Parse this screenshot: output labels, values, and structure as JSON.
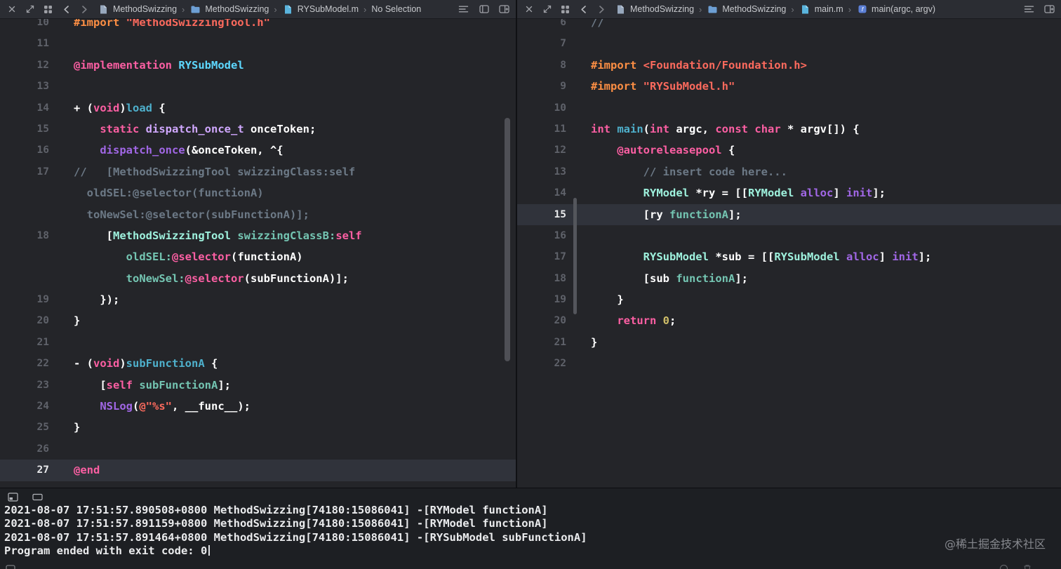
{
  "ui": {
    "breadcrumb_separator": "›"
  },
  "colors": {
    "plain": "#ffffff",
    "keyword": "#FC5FA3",
    "preproc": "#FD8F44",
    "string": "#FC6A5D",
    "comment": "#6C7986",
    "typeDecl": "#5DD8FF",
    "decl": "#4EB0CC",
    "projClass": "#9EF1DD",
    "projMethod": "#74C5B2",
    "otherFn": "#A167E6",
    "otherType": "#D0A8FF",
    "number": "#D0BF69"
  },
  "left_pane": {
    "toolbar_left": [
      "close",
      "expand",
      "grid",
      "back",
      "forward"
    ],
    "toolbar_right": [
      "list",
      "layout",
      "add-editor"
    ],
    "breadcrumbs": [
      {
        "icon": "file",
        "label": "MethodSwizzing"
      },
      {
        "icon": "folder",
        "label": "MethodSwizzing"
      },
      {
        "icon": "file-m",
        "label": "RYSubModel.m"
      },
      {
        "icon": "",
        "label": "No Selection"
      }
    ],
    "rows": [
      {
        "num": "10",
        "segs": [
          {
            "c": "preproc",
            "t": "#import "
          },
          {
            "c": "string",
            "t": "\"MethodSwizzingTool.h\""
          }
        ]
      },
      {
        "num": "11",
        "segs": []
      },
      {
        "num": "12",
        "segs": [
          {
            "c": "keyword",
            "t": "@implementation"
          },
          {
            "c": "plain",
            "t": " "
          },
          {
            "c": "typeDecl",
            "t": "RYSubModel"
          }
        ]
      },
      {
        "num": "13",
        "segs": []
      },
      {
        "num": "14",
        "segs": [
          {
            "c": "plain",
            "t": "+ ("
          },
          {
            "c": "keyword",
            "t": "void"
          },
          {
            "c": "plain",
            "t": ")"
          },
          {
            "c": "decl",
            "t": "load"
          },
          {
            "c": "plain",
            "t": " {"
          }
        ]
      },
      {
        "num": "15",
        "segs": [
          {
            "c": "plain",
            "t": "    "
          },
          {
            "c": "keyword",
            "t": "static"
          },
          {
            "c": "plain",
            "t": " "
          },
          {
            "c": "otherType",
            "t": "dispatch_once_t"
          },
          {
            "c": "plain",
            "t": " onceToken;"
          }
        ]
      },
      {
        "num": "16",
        "segs": [
          {
            "c": "plain",
            "t": "    "
          },
          {
            "c": "otherFn",
            "t": "dispatch_once"
          },
          {
            "c": "plain",
            "t": "(&onceToken, ^{"
          }
        ]
      },
      {
        "num": "17",
        "segs": [
          {
            "c": "comment",
            "t": "//   [MethodSwizzingTool swizzingClass:self"
          }
        ]
      },
      {
        "num": "",
        "segs": [
          {
            "c": "comment",
            "t": "  oldSEL:@selector(functionA)"
          }
        ]
      },
      {
        "num": "",
        "segs": [
          {
            "c": "comment",
            "t": "  toNewSel:@selector(subFunctionA)];"
          }
        ]
      },
      {
        "num": "18",
        "segs": [
          {
            "c": "plain",
            "t": "     ["
          },
          {
            "c": "projClass",
            "t": "MethodSwizzingTool"
          },
          {
            "c": "plain",
            "t": " "
          },
          {
            "c": "projMethod",
            "t": "swizzingClassB:"
          },
          {
            "c": "keyword",
            "t": "self"
          }
        ]
      },
      {
        "num": "",
        "segs": [
          {
            "c": "plain",
            "t": "        "
          },
          {
            "c": "projMethod",
            "t": "oldSEL:"
          },
          {
            "c": "keyword",
            "t": "@selector"
          },
          {
            "c": "plain",
            "t": "(functionA)"
          }
        ]
      },
      {
        "num": "",
        "segs": [
          {
            "c": "plain",
            "t": "        "
          },
          {
            "c": "projMethod",
            "t": "toNewSel:"
          },
          {
            "c": "keyword",
            "t": "@selector"
          },
          {
            "c": "plain",
            "t": "(subFunctionA)];"
          }
        ]
      },
      {
        "num": "19",
        "segs": [
          {
            "c": "plain",
            "t": "    });"
          }
        ]
      },
      {
        "num": "20",
        "segs": [
          {
            "c": "plain",
            "t": "}"
          }
        ]
      },
      {
        "num": "21",
        "segs": []
      },
      {
        "num": "22",
        "segs": [
          {
            "c": "plain",
            "t": "- ("
          },
          {
            "c": "keyword",
            "t": "void"
          },
          {
            "c": "plain",
            "t": ")"
          },
          {
            "c": "decl",
            "t": "subFunctionA"
          },
          {
            "c": "plain",
            "t": " {"
          }
        ]
      },
      {
        "num": "23",
        "segs": [
          {
            "c": "plain",
            "t": "    ["
          },
          {
            "c": "keyword",
            "t": "self"
          },
          {
            "c": "plain",
            "t": " "
          },
          {
            "c": "projMethod",
            "t": "subFunctionA"
          },
          {
            "c": "plain",
            "t": "];"
          }
        ]
      },
      {
        "num": "24",
        "segs": [
          {
            "c": "plain",
            "t": "    "
          },
          {
            "c": "otherFn",
            "t": "NSLog"
          },
          {
            "c": "plain",
            "t": "("
          },
          {
            "c": "string",
            "t": "@\"%s\""
          },
          {
            "c": "plain",
            "t": ", __func__);"
          }
        ]
      },
      {
        "num": "25",
        "segs": [
          {
            "c": "plain",
            "t": "}"
          }
        ]
      },
      {
        "num": "26",
        "segs": []
      },
      {
        "num": "27",
        "hl": true,
        "segs": [
          {
            "c": "keyword",
            "t": "@end"
          }
        ]
      }
    ]
  },
  "right_pane": {
    "toolbar_left": [
      "close",
      "expand",
      "grid",
      "back",
      "forward"
    ],
    "toolbar_right": [
      "list",
      "add-editor"
    ],
    "breadcrumbs": [
      {
        "icon": "file",
        "label": "MethodSwizzing"
      },
      {
        "icon": "folder",
        "label": "MethodSwizzing"
      },
      {
        "icon": "file-m",
        "label": "main.m"
      },
      {
        "icon": "fn",
        "label": "main(argc, argv)"
      }
    ],
    "rows": [
      {
        "num": "6",
        "segs": [
          {
            "c": "comment",
            "t": "//"
          }
        ]
      },
      {
        "num": "7",
        "segs": []
      },
      {
        "num": "8",
        "segs": [
          {
            "c": "preproc",
            "t": "#import "
          },
          {
            "c": "string",
            "t": "<Foundation/Foundation.h>"
          }
        ]
      },
      {
        "num": "9",
        "segs": [
          {
            "c": "preproc",
            "t": "#import "
          },
          {
            "c": "string",
            "t": "\"RYSubModel.h\""
          }
        ]
      },
      {
        "num": "10",
        "segs": []
      },
      {
        "num": "11",
        "segs": [
          {
            "c": "keyword",
            "t": "int"
          },
          {
            "c": "plain",
            "t": " "
          },
          {
            "c": "decl",
            "t": "main"
          },
          {
            "c": "plain",
            "t": "("
          },
          {
            "c": "keyword",
            "t": "int"
          },
          {
            "c": "plain",
            "t": " argc, "
          },
          {
            "c": "keyword",
            "t": "const"
          },
          {
            "c": "plain",
            "t": " "
          },
          {
            "c": "keyword",
            "t": "char"
          },
          {
            "c": "plain",
            "t": " * argv[]) {"
          }
        ]
      },
      {
        "num": "12",
        "segs": [
          {
            "c": "plain",
            "t": "    "
          },
          {
            "c": "keyword",
            "t": "@autoreleasepool"
          },
          {
            "c": "plain",
            "t": " {"
          }
        ]
      },
      {
        "num": "13",
        "segs": [
          {
            "c": "plain",
            "t": "        "
          },
          {
            "c": "comment",
            "t": "// insert code here..."
          }
        ]
      },
      {
        "num": "14",
        "segs": [
          {
            "c": "plain",
            "t": "        "
          },
          {
            "c": "projClass",
            "t": "RYModel"
          },
          {
            "c": "plain",
            "t": " *ry = [["
          },
          {
            "c": "projClass",
            "t": "RYModel"
          },
          {
            "c": "plain",
            "t": " "
          },
          {
            "c": "otherFn",
            "t": "alloc"
          },
          {
            "c": "plain",
            "t": "] "
          },
          {
            "c": "otherFn",
            "t": "init"
          },
          {
            "c": "plain",
            "t": "];"
          }
        ]
      },
      {
        "num": "15",
        "hl": true,
        "segs": [
          {
            "c": "plain",
            "t": "        [ry "
          },
          {
            "c": "projMethod",
            "t": "functionA"
          },
          {
            "c": "plain",
            "t": "];"
          }
        ]
      },
      {
        "num": "16",
        "segs": []
      },
      {
        "num": "17",
        "segs": [
          {
            "c": "plain",
            "t": "        "
          },
          {
            "c": "projClass",
            "t": "RYSubModel"
          },
          {
            "c": "plain",
            "t": " *sub = [["
          },
          {
            "c": "projClass",
            "t": "RYSubModel"
          },
          {
            "c": "plain",
            "t": " "
          },
          {
            "c": "otherFn",
            "t": "alloc"
          },
          {
            "c": "plain",
            "t": "] "
          },
          {
            "c": "otherFn",
            "t": "init"
          },
          {
            "c": "plain",
            "t": "];"
          }
        ]
      },
      {
        "num": "18",
        "segs": [
          {
            "c": "plain",
            "t": "        [sub "
          },
          {
            "c": "projMethod",
            "t": "functionA"
          },
          {
            "c": "plain",
            "t": "];"
          }
        ]
      },
      {
        "num": "19",
        "segs": [
          {
            "c": "plain",
            "t": "    }"
          }
        ]
      },
      {
        "num": "20",
        "segs": [
          {
            "c": "plain",
            "t": "    "
          },
          {
            "c": "keyword",
            "t": "return"
          },
          {
            "c": "plain",
            "t": " "
          },
          {
            "c": "number",
            "t": "0"
          },
          {
            "c": "plain",
            "t": ";"
          }
        ]
      },
      {
        "num": "21",
        "segs": [
          {
            "c": "plain",
            "t": "}"
          }
        ]
      },
      {
        "num": "22",
        "segs": []
      }
    ]
  },
  "console": {
    "toolbar_icons": [
      "variables-view",
      "console-view"
    ],
    "lines": [
      "2021-08-07 17:51:57.890508+0800 MethodSwizzing[74180:15086041] -[RYModel functionA]",
      "2021-08-07 17:51:57.891159+0800 MethodSwizzing[74180:15086041] -[RYModel functionA]",
      "2021-08-07 17:51:57.891464+0800 MethodSwizzing[74180:15086041] -[RYSubModel subFunctionA]",
      "Program ended with exit code: 0"
    ],
    "bottom_icons": [
      "circle",
      "trash"
    ],
    "watermark": "@稀土掘金技术社区"
  }
}
